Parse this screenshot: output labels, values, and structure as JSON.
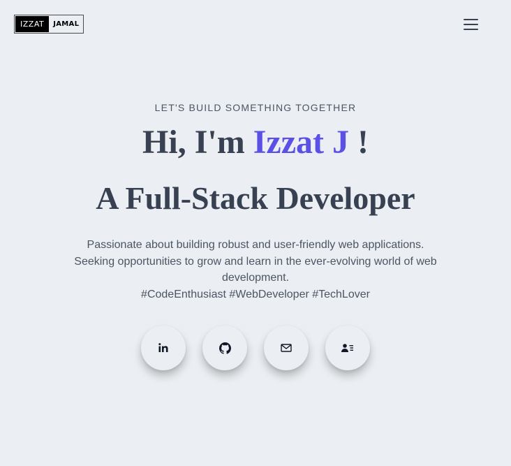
{
  "logo": {
    "left": "IZZAT",
    "right": "JAMAL"
  },
  "nav": {
    "menu_icon": "hamburger-menu-icon"
  },
  "hero": {
    "tagline": "LET'S BUILD SOMETHING TOGETHER",
    "greeting_prefix": "Hi, I'm ",
    "name": "Izzat J",
    "greeting_suffix": " !",
    "role": "A Full-Stack Developer",
    "description_line1": "Passionate about building robust and user-friendly web applications. Seeking opportunities to grow and learn in the ever-evolving world of web development.",
    "hashtags": "#CodeEnthusiast #WebDeveloper #TechLover"
  },
  "socials": [
    {
      "icon": "linkedin-icon"
    },
    {
      "icon": "github-icon"
    },
    {
      "icon": "mail-icon"
    },
    {
      "icon": "contact-card-icon"
    }
  ],
  "colors": {
    "background": "#ebeef2",
    "text": "#374151",
    "accent": "#5b50e6"
  }
}
